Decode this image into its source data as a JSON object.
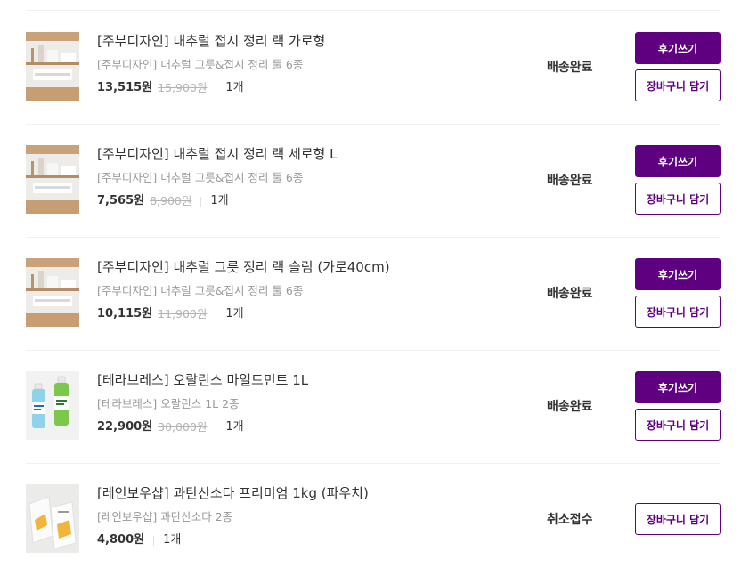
{
  "items": [
    {
      "name": "[주부디자인] 내추럴 접시 정리 랙 가로형",
      "option": "[주부디자인] 내추럴 그릇&접시 정리 툴 6종",
      "price": "13,515원",
      "original_price": "15,900원",
      "quantity": "1개",
      "status": "배송완료",
      "review_label": "후기쓰기",
      "cart_label": "장바구니 담기",
      "image_icon": "dish-rack-product-image"
    },
    {
      "name": "[주부디자인] 내추럴 접시 정리 랙 세로형 L",
      "option": "[주부디자인] 내추럴 그릇&접시 정리 툴 6종",
      "price": "7,565원",
      "original_price": "8,900원",
      "quantity": "1개",
      "status": "배송완료",
      "review_label": "후기쓰기",
      "cart_label": "장바구니 담기",
      "image_icon": "dish-rack-product-image"
    },
    {
      "name": "[주부디자인] 내추럴 그릇 정리 랙 슬림 (가로40cm)",
      "option": "[주부디자인] 내추럴 그릇&접시 정리 툴 6종",
      "price": "10,115원",
      "original_price": "11,900원",
      "quantity": "1개",
      "status": "배송완료",
      "review_label": "후기쓰기",
      "cart_label": "장바구니 담기",
      "image_icon": "dish-rack-product-image"
    },
    {
      "name": "[테라브레스] 오랄린스 마일드민트 1L",
      "option": "[테라브레스] 오랄린스 1L 2종",
      "price": "22,900원",
      "original_price": "30,000원",
      "quantity": "1개",
      "status": "배송완료",
      "review_label": "후기쓰기",
      "cart_label": "장바구니 담기",
      "image_icon": "mouthwash-bottles-image"
    },
    {
      "name": "[레인보우샵] 과탄산소다 프리미엄 1kg (파우치)",
      "option": "[레인보우샵] 과탄산소다 2종",
      "price": "4,800원",
      "original_price": "",
      "quantity": "1개",
      "status": "취소접수",
      "review_label": "",
      "cart_label": "장바구니 담기",
      "image_icon": "pouch-product-image"
    }
  ],
  "colors": {
    "accent": "#5f0080",
    "divider": "#f0f0f0",
    "muted": "#999999"
  }
}
